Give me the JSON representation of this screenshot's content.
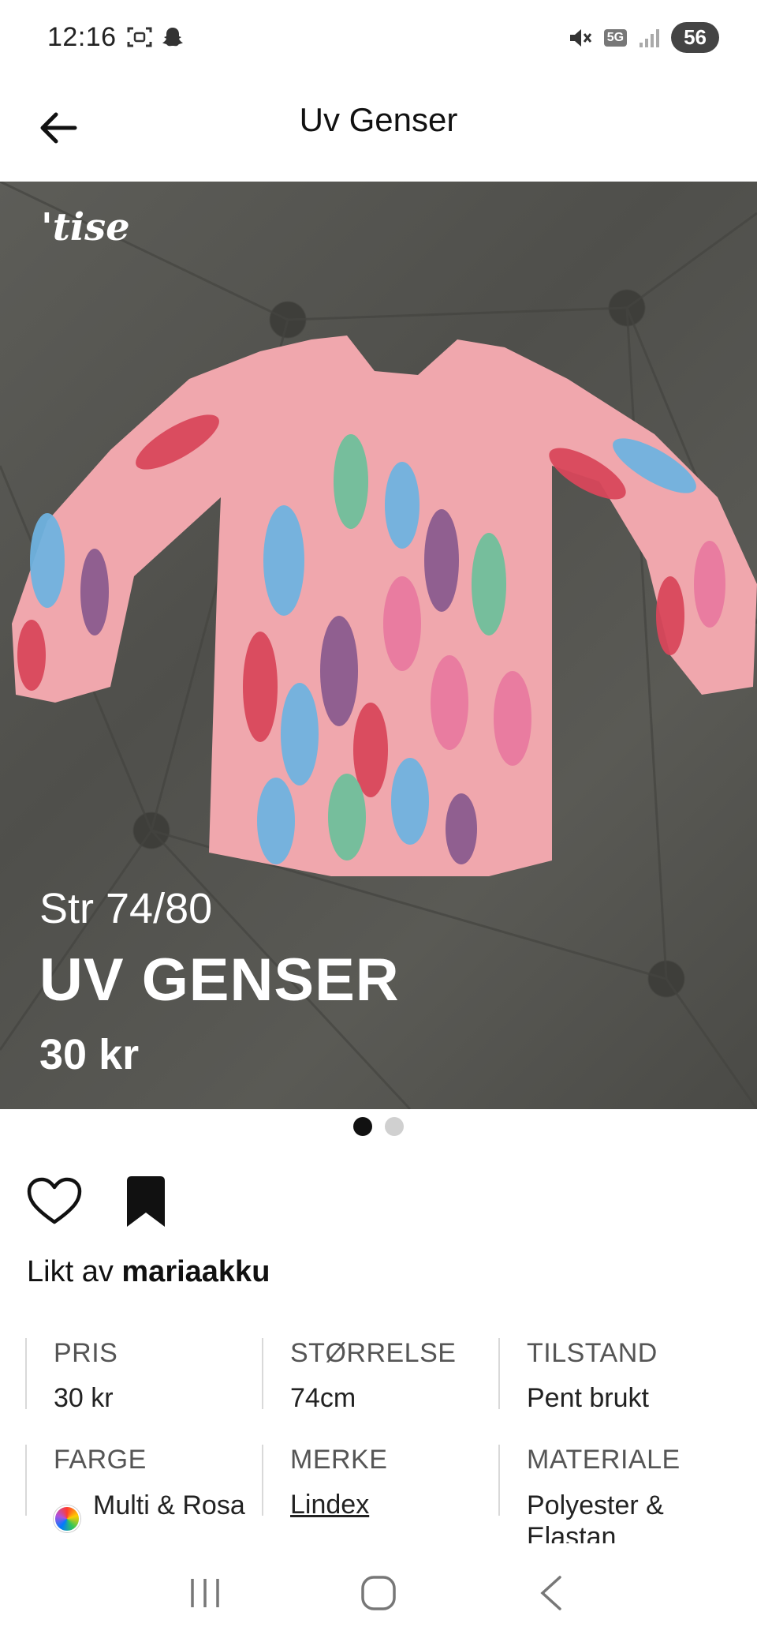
{
  "status_bar": {
    "time": "12:16",
    "network_badge": "5G",
    "battery": "56"
  },
  "header": {
    "title": "Uv Genser"
  },
  "image": {
    "watermark": "'tise",
    "overlay_size": "Str 74/80",
    "overlay_title": "UV GENSER",
    "overlay_price": "30 kr",
    "page_count": 2,
    "active_page": 1
  },
  "likes": {
    "prefix": "Likt av",
    "user": "mariaakku"
  },
  "details": {
    "pris": {
      "label": "PRIS",
      "value": "30 kr"
    },
    "storrelse": {
      "label": "STØRRELSE",
      "value": "74cm"
    },
    "tilstand": {
      "label": "TILSTAND",
      "value": "Pent brukt"
    },
    "farge": {
      "label": "FARGE",
      "value": "Multi & Rosa"
    },
    "merke": {
      "label": "MERKE",
      "value": "Lindex"
    },
    "materiale": {
      "label": "MATERIALE",
      "value": "Polyester & Elastan"
    }
  },
  "icons": [
    "back-arrow-icon",
    "heart-icon",
    "bookmark-icon",
    "recents-icon",
    "home-icon",
    "back-nav-icon"
  ]
}
